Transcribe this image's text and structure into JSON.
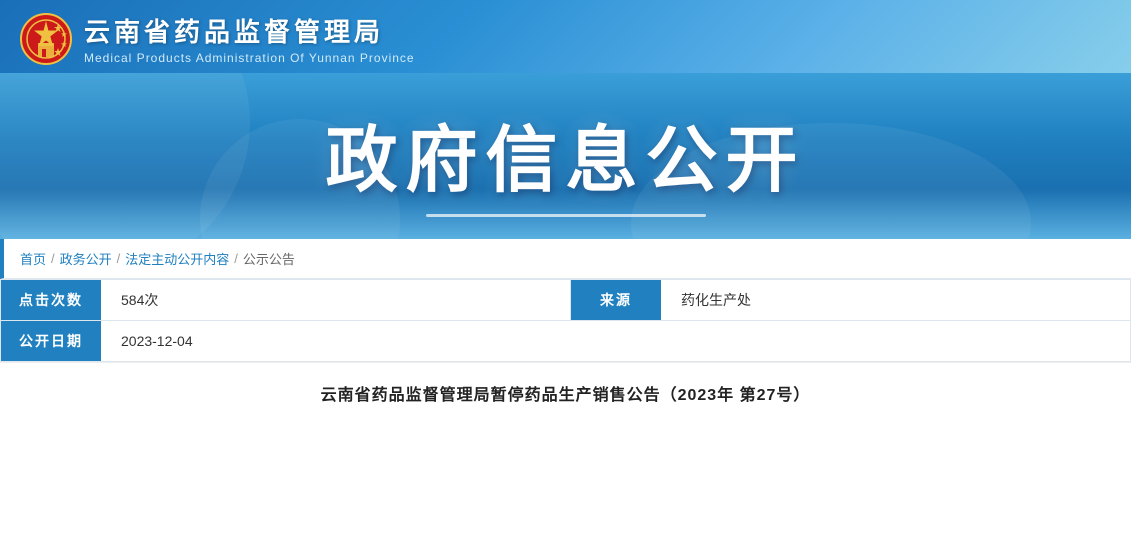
{
  "header": {
    "org_name_cn": "云南省药品监督管理局",
    "org_name_en": "Medical Products Administration Of Yunnan Province"
  },
  "banner": {
    "main_title": "政府信息公开"
  },
  "breadcrumb": {
    "items": [
      {
        "label": "首页",
        "is_link": true
      },
      {
        "sep": "/"
      },
      {
        "label": "政务公开",
        "is_link": true
      },
      {
        "sep": "/"
      },
      {
        "label": "法定主动公开内容",
        "is_link": true
      },
      {
        "sep": "/"
      },
      {
        "label": "公示公告",
        "is_link": false
      }
    ]
  },
  "meta": {
    "views_label": "点击次数",
    "views_value": "584次",
    "source_label": "来源",
    "source_value": "药化生产处",
    "date_label": "公开日期",
    "date_value": "2023-12-04"
  },
  "article": {
    "title": "云南省药品监督管理局暂停药品生产销售公告（2023年 第27号）"
  }
}
